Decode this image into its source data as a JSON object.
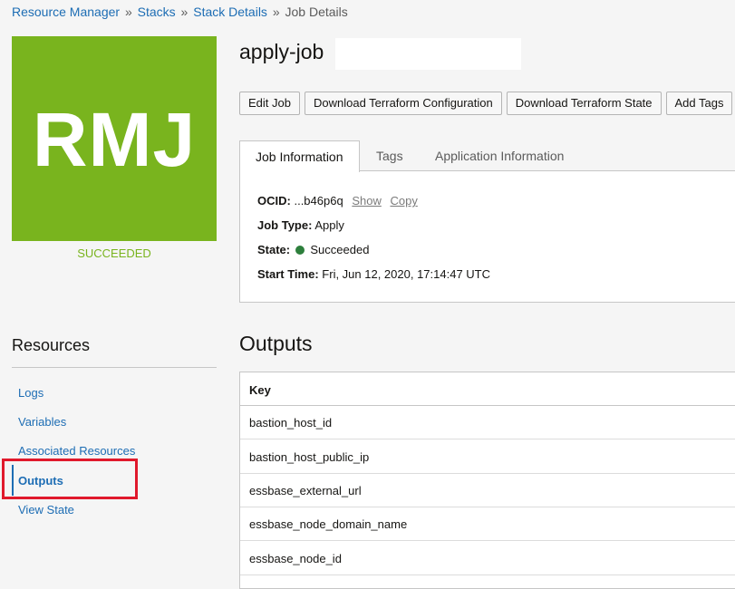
{
  "breadcrumb": {
    "items": [
      "Resource Manager",
      "Stacks",
      "Stack Details"
    ],
    "separator": "»",
    "current": "Job Details"
  },
  "badge": {
    "text": "RMJ",
    "status": "SUCCEEDED",
    "color": "#79b41e"
  },
  "job": {
    "title": "apply-job"
  },
  "actions": {
    "edit_job": "Edit Job",
    "download_config": "Download Terraform Configuration",
    "download_state": "Download Terraform State",
    "add_tags": "Add Tags"
  },
  "tabs": {
    "job_information": "Job Information",
    "tags": "Tags",
    "application_information": "Application Information"
  },
  "info": {
    "ocid_label": "OCID:",
    "ocid_value": "...b46p6q",
    "show_link": "Show",
    "copy_link": "Copy",
    "job_type_label": "Job Type:",
    "job_type_value": "Apply",
    "state_label": "State:",
    "state_value": "Succeeded",
    "state_color": "#2d7f3c",
    "start_time_label": "Start Time:",
    "start_time_value": "Fri, Jun 12, 2020, 17:14:47 UTC"
  },
  "resources": {
    "title": "Resources",
    "items": [
      "Logs",
      "Variables",
      "Associated Resources",
      "Outputs",
      "View State"
    ],
    "active": "Outputs"
  },
  "outputs": {
    "title": "Outputs",
    "column_key": "Key",
    "rows": [
      "bastion_host_id",
      "bastion_host_public_ip",
      "essbase_external_url",
      "essbase_node_domain_name",
      "essbase_node_id"
    ]
  },
  "colors": {
    "link": "#1d6db4",
    "highlight": "#e0192c"
  }
}
